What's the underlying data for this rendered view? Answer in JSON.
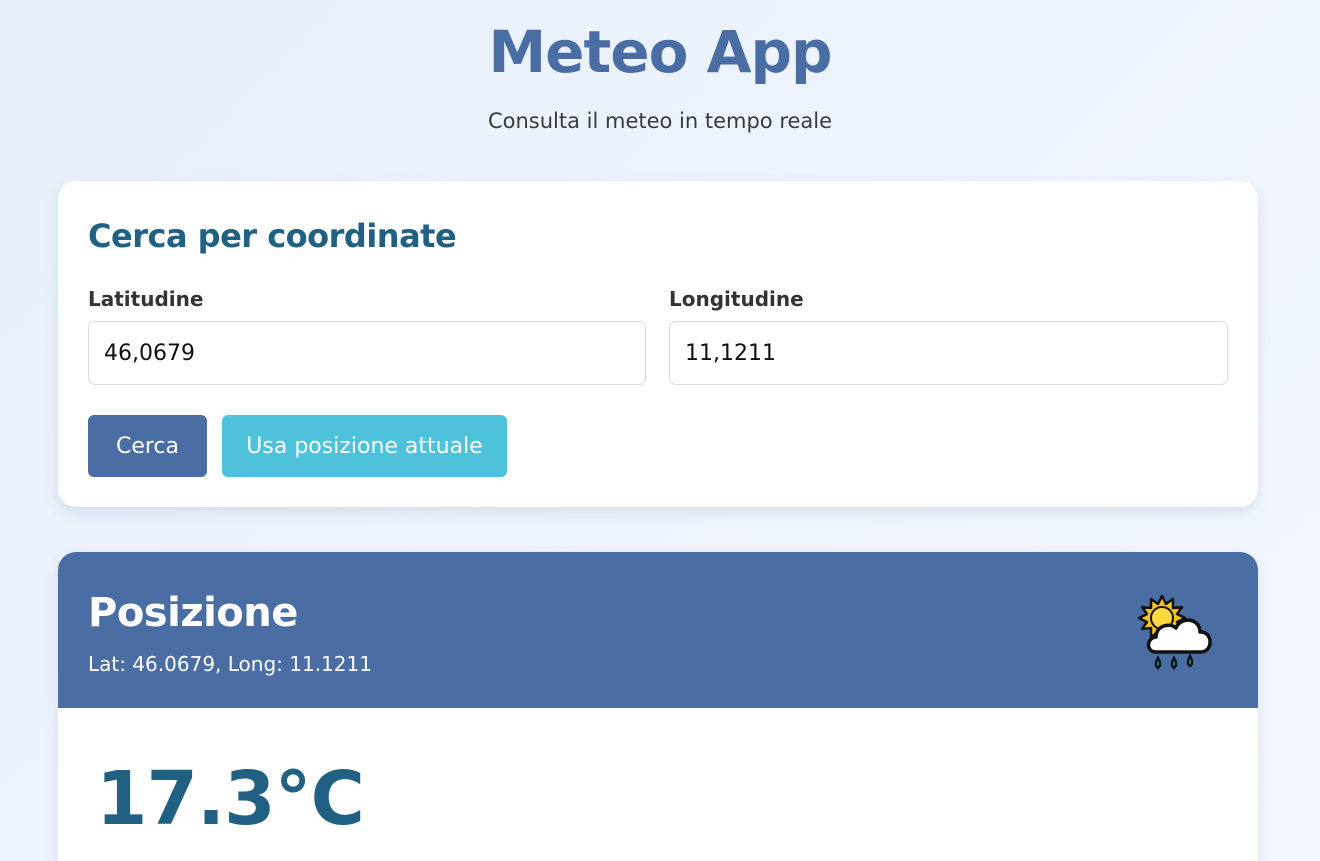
{
  "header": {
    "title": "Meteo App",
    "subtitle": "Consulta il meteo in tempo reale"
  },
  "search": {
    "title": "Cerca per coordinate",
    "latitude_label": "Latitudine",
    "latitude_value": "46,0679",
    "longitude_label": "Longitudine",
    "longitude_value": "11,1211",
    "search_button": "Cerca",
    "location_button": "Usa posizione attuale"
  },
  "weather": {
    "location_name": "Posizione",
    "coords": "Lat: 46.0679, Long: 11.1211",
    "icon": "sun-behind-rain-cloud-icon",
    "temperature": "17.3°C"
  },
  "colors": {
    "primary": "#4a6da4",
    "accent": "#4fc2db",
    "heading": "#1f6083",
    "background": "#eef4fd"
  }
}
